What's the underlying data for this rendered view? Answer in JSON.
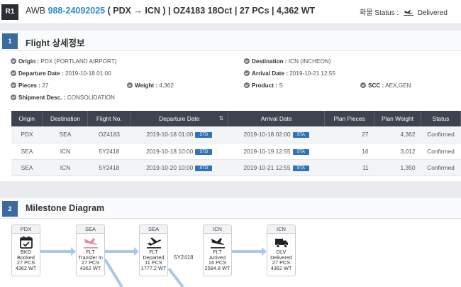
{
  "header": {
    "badge": "R1",
    "awb_label": "AWB",
    "awb_number": "988-24092025",
    "awb_rest": "( PDX → ICN ) | OZ4183 18Oct | 27 PCs | 4,362 WT",
    "status_label": "화물 Status :",
    "status_value": "Delivered"
  },
  "flight": {
    "badge": "1",
    "title": "Flight 상세정보",
    "origin_label": "Origin :",
    "origin_value": "PDX (PORTLAND AIRPORT)",
    "destination_label": "Destination :",
    "destination_value": "ICN (INCHEON)",
    "departure_label": "Departure Date :",
    "departure_value": "2019-10-18 01:00",
    "arrival_label": "Arrival Date :",
    "arrival_value": "2019-10-21 12:55",
    "pieces_label": "Pieces :",
    "pieces_value": "27",
    "weight_label": "Weight :",
    "weight_value": "4,362",
    "product_label": "Product :",
    "product_value": "S",
    "scc_label": "SCC :",
    "scc_value": "AEX,GEN",
    "shipment_label": "Shipment Desc. :",
    "shipment_value": "CONSOLIDATION",
    "columns": [
      "Origin",
      "Destination",
      "Flight No.",
      "Departure Date",
      "Arrival Date",
      "Plan Pieces",
      "Plan Weight",
      "Status"
    ],
    "rows": [
      {
        "origin": "PDX",
        "dest": "SEA",
        "flight": "OZ4183",
        "dep": "2019-10-18 01:00",
        "dep_tag": "STD",
        "arr": "2019-10-18 02:00",
        "arr_tag": "STA",
        "pieces": "27",
        "weight": "4,362",
        "status": "Confirmed"
      },
      {
        "origin": "SEA",
        "dest": "ICN",
        "flight": "5Y2418",
        "dep": "2019-10-18 10:00",
        "dep_tag": "STD",
        "arr": "2019-10-19 12:55",
        "arr_tag": "STA",
        "pieces": "16",
        "weight": "3,012",
        "status": "Confirmed"
      },
      {
        "origin": "SEA",
        "dest": "ICN",
        "flight": "5Y2418",
        "dep": "2019-10-20 10:00",
        "dep_tag": "STD",
        "arr": "2019-10-21 12:55",
        "arr_tag": "STA",
        "pieces": "11",
        "weight": "1,350",
        "status": "Confirmed"
      }
    ]
  },
  "milestone": {
    "badge": "2",
    "title": "Milestone Diagram",
    "edge_label": "5Y2418",
    "nodes": [
      {
        "station": "PDX",
        "icon": "calendar-check-icon",
        "l1": "BKD",
        "l2": "Booked",
        "l3": "27 PCS",
        "l4": "4362 WT"
      },
      {
        "station": "SEA",
        "icon": "plane-landing-icon",
        "l1": "FLT",
        "l2": "Transfer In",
        "l3": "27 PCS",
        "l4": "4362 WT"
      },
      {
        "station": "SEA",
        "icon": "plane-departure-icon",
        "l1": "FLT",
        "l2": "Departed",
        "l3": "11 PCS",
        "l4": "1777.2 WT"
      },
      {
        "station": "ICN",
        "icon": "plane-landing-icon",
        "l1": "FLT",
        "l2": "Arrived",
        "l3": "16 PCS",
        "l4": "2584.8 WT"
      },
      {
        "station": "ICN",
        "icon": "truck-icon",
        "l1": "DLV",
        "l2": "Delivered",
        "l3": "27 PCS",
        "l4": "4362 WT"
      }
    ]
  },
  "colors": {
    "accent": "#2a8ec7",
    "header_dark": "#3d4350",
    "tag_blue": "#2f73b8",
    "arrow": "#a9c7ea"
  }
}
